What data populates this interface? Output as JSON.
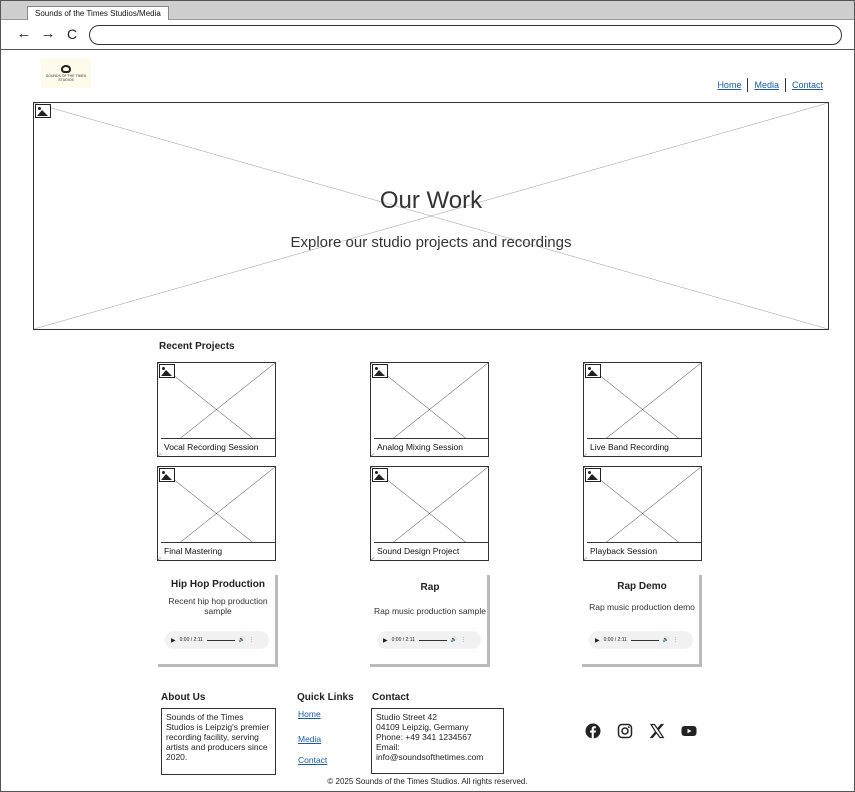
{
  "browser": {
    "tab_title": "Sounds of the Times Studios/Media",
    "back_glyph": "←",
    "forward_glyph": "→",
    "reload_glyph": "C",
    "address": ""
  },
  "logo": {
    "text": "SOUNDS OF THE TIMES STUDIOS"
  },
  "nav": {
    "home": "Home",
    "media": "Media",
    "contact": "Contact"
  },
  "hero": {
    "title": "Our Work",
    "subtitle": "Explore our studio projects and recordings"
  },
  "projects": {
    "title": "Recent Projects",
    "items": [
      {
        "label": "Vocal Recording Session"
      },
      {
        "label": "Analog Mixing Session"
      },
      {
        "label": "Live Band Recording"
      },
      {
        "label": "Final Mastering"
      },
      {
        "label": "Sound Design Project"
      },
      {
        "label": "Playback Session"
      }
    ]
  },
  "audio": [
    {
      "title": "Hip Hop Production",
      "description": "Recent hip hop production sample",
      "time": "0:00 / 2:11"
    },
    {
      "title": "Rap",
      "description": "Rap music production sample",
      "time": "0:00 / 2:11"
    },
    {
      "title": "Rap Demo",
      "description": "Rap music production demo",
      "time": "0:00 / 2:11"
    }
  ],
  "footer": {
    "about_title": "About Us",
    "about_text": "Sounds of the Times Studios is Leipzig's premier recording facility, serving artists and producers since 2020.",
    "links_title": "Quick Links",
    "links": [
      "Home",
      "Media",
      "Contact"
    ],
    "contact_title": "Contact",
    "contact_lines": [
      "Studio Street 42",
      "04109 Leipzig, Germany",
      "Phone: +49 341 1234567",
      "Email:",
      "info@soundsofthetimes.com"
    ],
    "social_icons": [
      "facebook-icon",
      "instagram-icon",
      "x-icon",
      "youtube-icon"
    ],
    "copyright": "© 2025 Sounds of the Times Studios. All rights reserved."
  }
}
